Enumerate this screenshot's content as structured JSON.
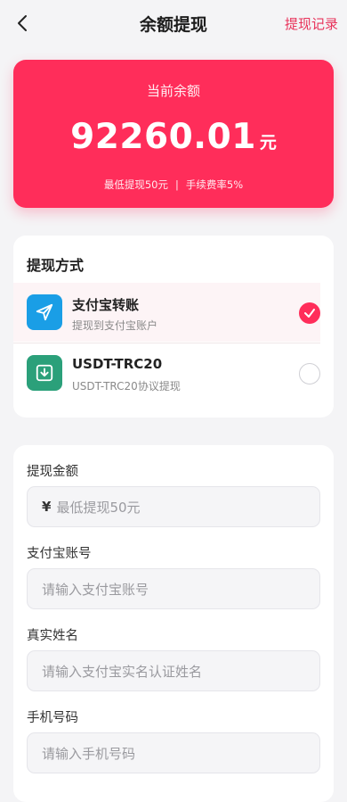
{
  "header": {
    "title": "余额提现",
    "records_label": "提现记录"
  },
  "balance": {
    "label": "当前余额",
    "amount": "92260.01",
    "unit": "元",
    "min_withdraw": "最低提现50元",
    "separator": "|",
    "fee": "手续费率5%"
  },
  "methods": {
    "title": "提现方式",
    "items": [
      {
        "name": "支付宝转账",
        "desc": "提现到支付宝账户",
        "icon": "send-icon",
        "color": "#1a9ee6",
        "selected": true
      },
      {
        "name": "USDT-TRC20",
        "desc": "USDT-TRC20协议提现",
        "icon": "download-icon",
        "color": "#2ba07a",
        "selected": false
      }
    ]
  },
  "form": {
    "amount_label": "提现金额",
    "currency_symbol": "¥",
    "amount_placeholder": "最低提现50元",
    "account_label": "支付宝账号",
    "account_placeholder": "请输入支付宝账号",
    "name_label": "真实姓名",
    "name_placeholder": "请输入支付宝实名认证姓名",
    "phone_label": "手机号码",
    "phone_placeholder": "请输入手机号码"
  },
  "colors": {
    "accent": "#ff2d5a",
    "alipay": "#1a9ee6",
    "usdt": "#2ba07a"
  }
}
